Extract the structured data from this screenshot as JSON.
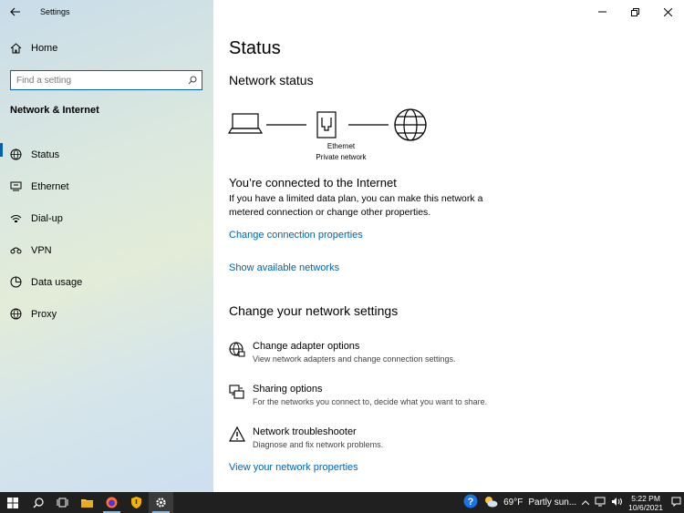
{
  "window": {
    "app_title": "Settings",
    "controls": {
      "minimize": "—",
      "maximize": "☐",
      "close": "✕"
    }
  },
  "sidebar": {
    "home_label": "Home",
    "search_placeholder": "Find a setting",
    "section_title": "Network & Internet",
    "items": [
      {
        "label": "Status",
        "icon": "globe-monitor-icon",
        "active": true
      },
      {
        "label": "Ethernet",
        "icon": "ethernet-icon",
        "active": false
      },
      {
        "label": "Dial-up",
        "icon": "dialup-icon",
        "active": false
      },
      {
        "label": "VPN",
        "icon": "vpn-icon",
        "active": false
      },
      {
        "label": "Data usage",
        "icon": "data-usage-icon",
        "active": false
      },
      {
        "label": "Proxy",
        "icon": "globe-icon",
        "active": false
      }
    ]
  },
  "main": {
    "title": "Status",
    "network_status_heading": "Network status",
    "diagram": {
      "adapter_name": "Ethernet",
      "network_profile": "Private network"
    },
    "connected_title": "You’re connected to the Internet",
    "connected_desc": "If you have a limited data plan, you can make this network a metered connection or change other properties.",
    "change_connection_link": "Change connection properties",
    "show_networks_link": "Show available networks",
    "change_settings_heading": "Change your network settings",
    "options": [
      {
        "title": "Change adapter options",
        "desc": "View network adapters and change connection settings.",
        "icon": "adapter-globe-icon"
      },
      {
        "title": "Sharing options",
        "desc": "For the networks you connect to, decide what you want to share.",
        "icon": "sharing-icon"
      },
      {
        "title": "Network troubleshooter",
        "desc": "Diagnose and fix network problems.",
        "icon": "warning-icon"
      }
    ],
    "view_properties_link": "View your network properties"
  },
  "taskbar": {
    "weather_temp": "69°F",
    "weather_desc": "Partly sun...",
    "time": "5:22 PM",
    "date": "10/6/2021"
  },
  "colors": {
    "accent": "#0063b1",
    "taskbar": "#202020"
  }
}
